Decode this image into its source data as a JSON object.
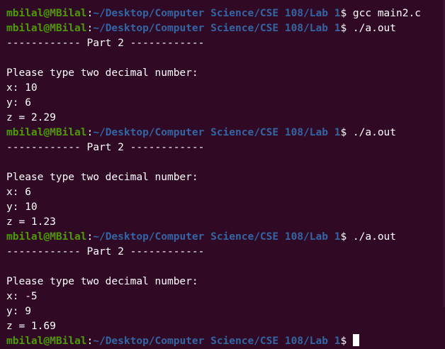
{
  "terminal": {
    "prompt": {
      "user_host": "mbilal@MBilal",
      "separator": ":",
      "path": "~/Desktop/Computer Science/CSE 108/Lab 1",
      "symbol": "$ "
    },
    "lines": [
      {
        "type": "prompt",
        "command": "gcc main2.c"
      },
      {
        "type": "prompt",
        "command": "./a.out"
      },
      {
        "type": "output",
        "text": "------------ Part 2 ------------"
      },
      {
        "type": "output",
        "text": ""
      },
      {
        "type": "output",
        "text": "Please type two decimal number:"
      },
      {
        "type": "output",
        "text": "x: 10"
      },
      {
        "type": "output",
        "text": "y: 6"
      },
      {
        "type": "output",
        "text": "z = 2.29"
      },
      {
        "type": "prompt",
        "command": "./a.out"
      },
      {
        "type": "output",
        "text": "------------ Part 2 ------------"
      },
      {
        "type": "output",
        "text": ""
      },
      {
        "type": "output",
        "text": "Please type two decimal number:"
      },
      {
        "type": "output",
        "text": "x: 6"
      },
      {
        "type": "output",
        "text": "y: 10"
      },
      {
        "type": "output",
        "text": "z = 1.23"
      },
      {
        "type": "prompt",
        "command": "./a.out"
      },
      {
        "type": "output",
        "text": "------------ Part 2 ------------"
      },
      {
        "type": "output",
        "text": ""
      },
      {
        "type": "output",
        "text": "Please type two decimal number:"
      },
      {
        "type": "output",
        "text": "x: -5"
      },
      {
        "type": "output",
        "text": "y: 9"
      },
      {
        "type": "output",
        "text": "z = 1.69"
      },
      {
        "type": "prompt",
        "command": "",
        "cursor": true
      }
    ]
  },
  "colors": {
    "background": "#300a24",
    "user_host": "#4e9a06",
    "path": "#3465a4",
    "text": "#ffffff"
  }
}
